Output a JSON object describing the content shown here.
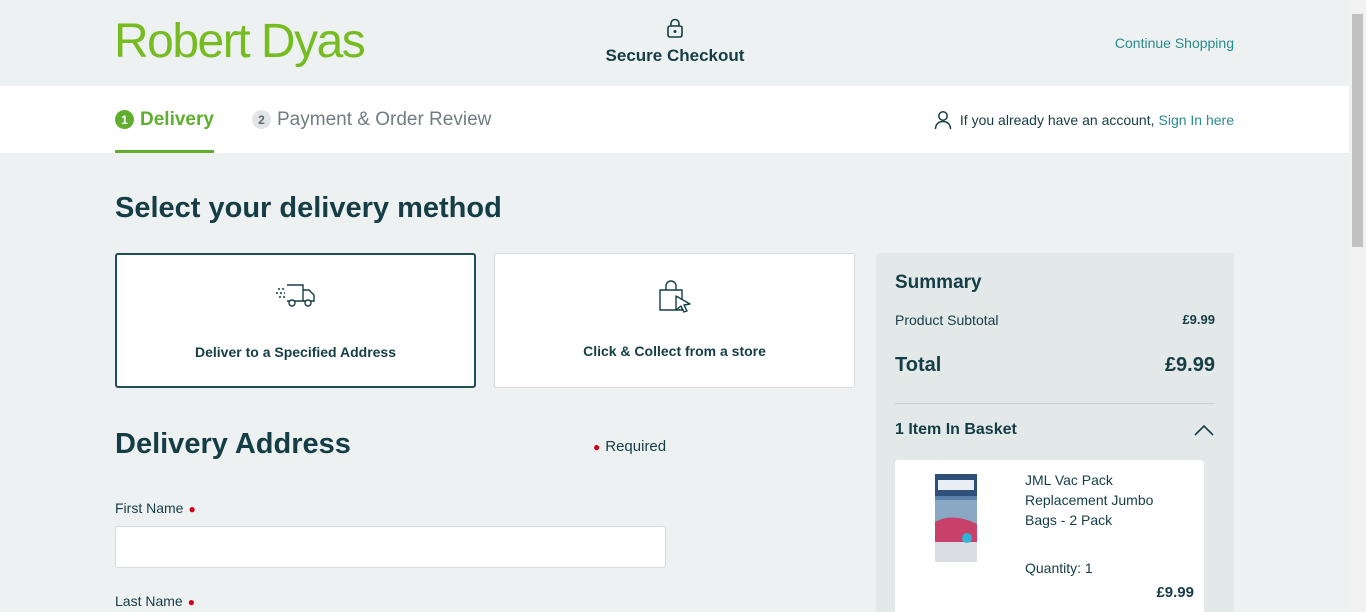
{
  "header": {
    "logo": "Robert Dyas",
    "secure_label": "Secure Checkout",
    "continue_link": "Continue Shopping"
  },
  "steps": [
    {
      "number": "1",
      "label": "Delivery"
    },
    {
      "number": "2",
      "label": "Payment & Order Review"
    }
  ],
  "account": {
    "prompt": "If you already have an account,",
    "sign_in_link": "Sign In here"
  },
  "delivery_method": {
    "heading": "Select your delivery method",
    "options": [
      {
        "label": "Deliver to a Specified Address",
        "icon": "delivery-truck-icon"
      },
      {
        "label": "Click & Collect from a store",
        "icon": "shopping-bag-click-icon"
      }
    ]
  },
  "address": {
    "title": "Delivery Address",
    "required_label": "Required",
    "first_name_label": "First Name",
    "first_name_value": "",
    "last_name_label": "Last Name"
  },
  "summary": {
    "title": "Summary",
    "subtotal_label": "Product Subtotal",
    "subtotal_value": "£9.99",
    "total_label": "Total",
    "total_value": "£9.99",
    "basket_label": "1 Item In Basket",
    "item": {
      "name": "JML Vac Pack Replacement Jumbo Bags - 2 Pack",
      "quantity": "Quantity: 1",
      "price": "£9.99"
    }
  },
  "colors": {
    "brand_green": "#76bc21",
    "active_step_green": "#5fae2e",
    "link_teal": "#2a8b8c",
    "text_dark": "#143d45",
    "required_red": "#d0021b"
  }
}
